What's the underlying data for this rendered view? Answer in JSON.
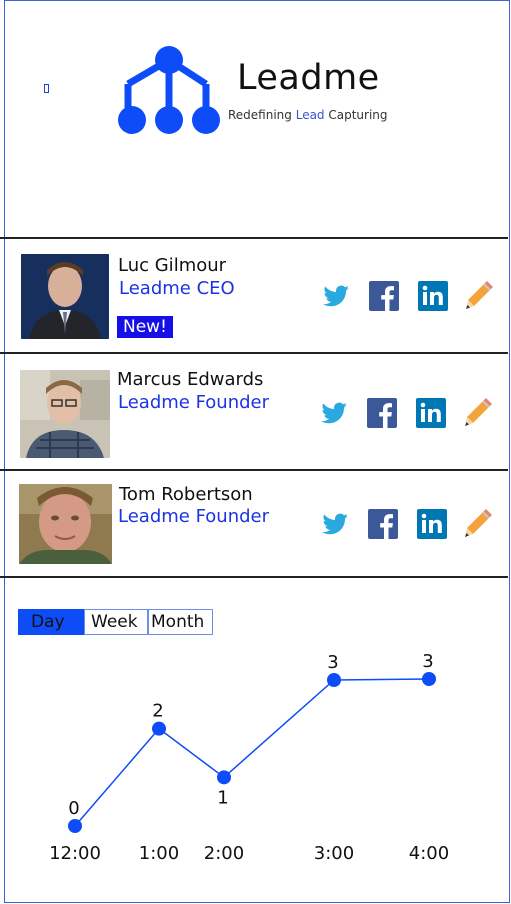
{
  "header": {
    "brand": "Leadme",
    "tagline_pre": "Redefining ",
    "tagline_accent": "Lead",
    "tagline_post": " Capturing"
  },
  "colors": {
    "accent": "#0d4cf6",
    "role": "#1d33e3",
    "badge": "#1710e6",
    "twitter": "#2aa9e0",
    "facebook": "#3b5998",
    "linkedin": "#0077b5"
  },
  "contacts": [
    {
      "name": "Luc Gilmour",
      "role": "Leadme CEO",
      "badge": "New!"
    },
    {
      "name": "Marcus Edwards",
      "role": "Leadme Founder"
    },
    {
      "name": "Tom Robertson",
      "role": "Leadme Founder"
    }
  ],
  "icons": [
    "twitter-icon",
    "facebook-icon",
    "linkedin-icon",
    "pencil-icon"
  ],
  "tabs": [
    {
      "label": "Day",
      "active": true
    },
    {
      "label": "Week",
      "active": false
    },
    {
      "label": "Month",
      "active": false
    }
  ],
  "chart_data": {
    "type": "line",
    "title": "",
    "xlabel": "",
    "ylabel": "",
    "categories": [
      "12:00",
      "1:00",
      "2:00",
      "3:00",
      "4:00"
    ],
    "values": [
      0,
      2,
      1,
      3,
      3
    ],
    "ylim": [
      0,
      3
    ],
    "grid": false
  }
}
